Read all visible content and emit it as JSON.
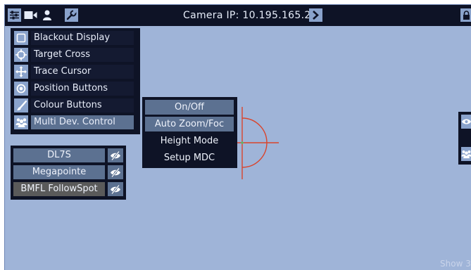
{
  "topbar": {
    "title": "Camera IP: 10.195.165.22",
    "icons": [
      "sliders-icon",
      "video-camera-icon",
      "user-icon",
      "wrench-icon",
      "chevron-right-icon",
      "lock-icon"
    ]
  },
  "overlay_menu": {
    "items": [
      {
        "label": "Blackout Display",
        "icon": "square-outline-icon"
      },
      {
        "label": "Target Cross",
        "icon": "crosshair-icon"
      },
      {
        "label": "Trace Cursor",
        "icon": "move-cross-icon"
      },
      {
        "label": "Position Buttons",
        "icon": "target-dot-icon"
      },
      {
        "label": "Colour Buttons",
        "icon": "paint-brush-icon"
      },
      {
        "label": "Multi Dev. Control",
        "icon": "users-icon",
        "active": true
      }
    ]
  },
  "mdc_submenu": {
    "items": [
      {
        "label": "On/Off"
      },
      {
        "label": "Auto Zoom/Foc"
      },
      {
        "label": "Height Mode"
      },
      {
        "label": "Setup MDC"
      }
    ]
  },
  "devices": {
    "items": [
      {
        "name": "DL7S",
        "visibility_icon": "eye-slash-icon"
      },
      {
        "name": "Megapointe",
        "visibility_icon": "eye-slash-icon"
      },
      {
        "name": "BMFL FollowSpot",
        "visibility_icon": "eye-slash-icon",
        "selected": true
      }
    ]
  },
  "right_panel": {
    "icons": [
      "eye-icon",
      "users-icon"
    ]
  },
  "footer": {
    "show_text": "Show 3"
  },
  "colors": {
    "background": "#9fb4d8",
    "panel": "#0e1326",
    "button": "#5c7191",
    "icon_bg": "#8aa3cc",
    "crosshair": "#d9442c",
    "selected_device": "#5a5a5a"
  }
}
